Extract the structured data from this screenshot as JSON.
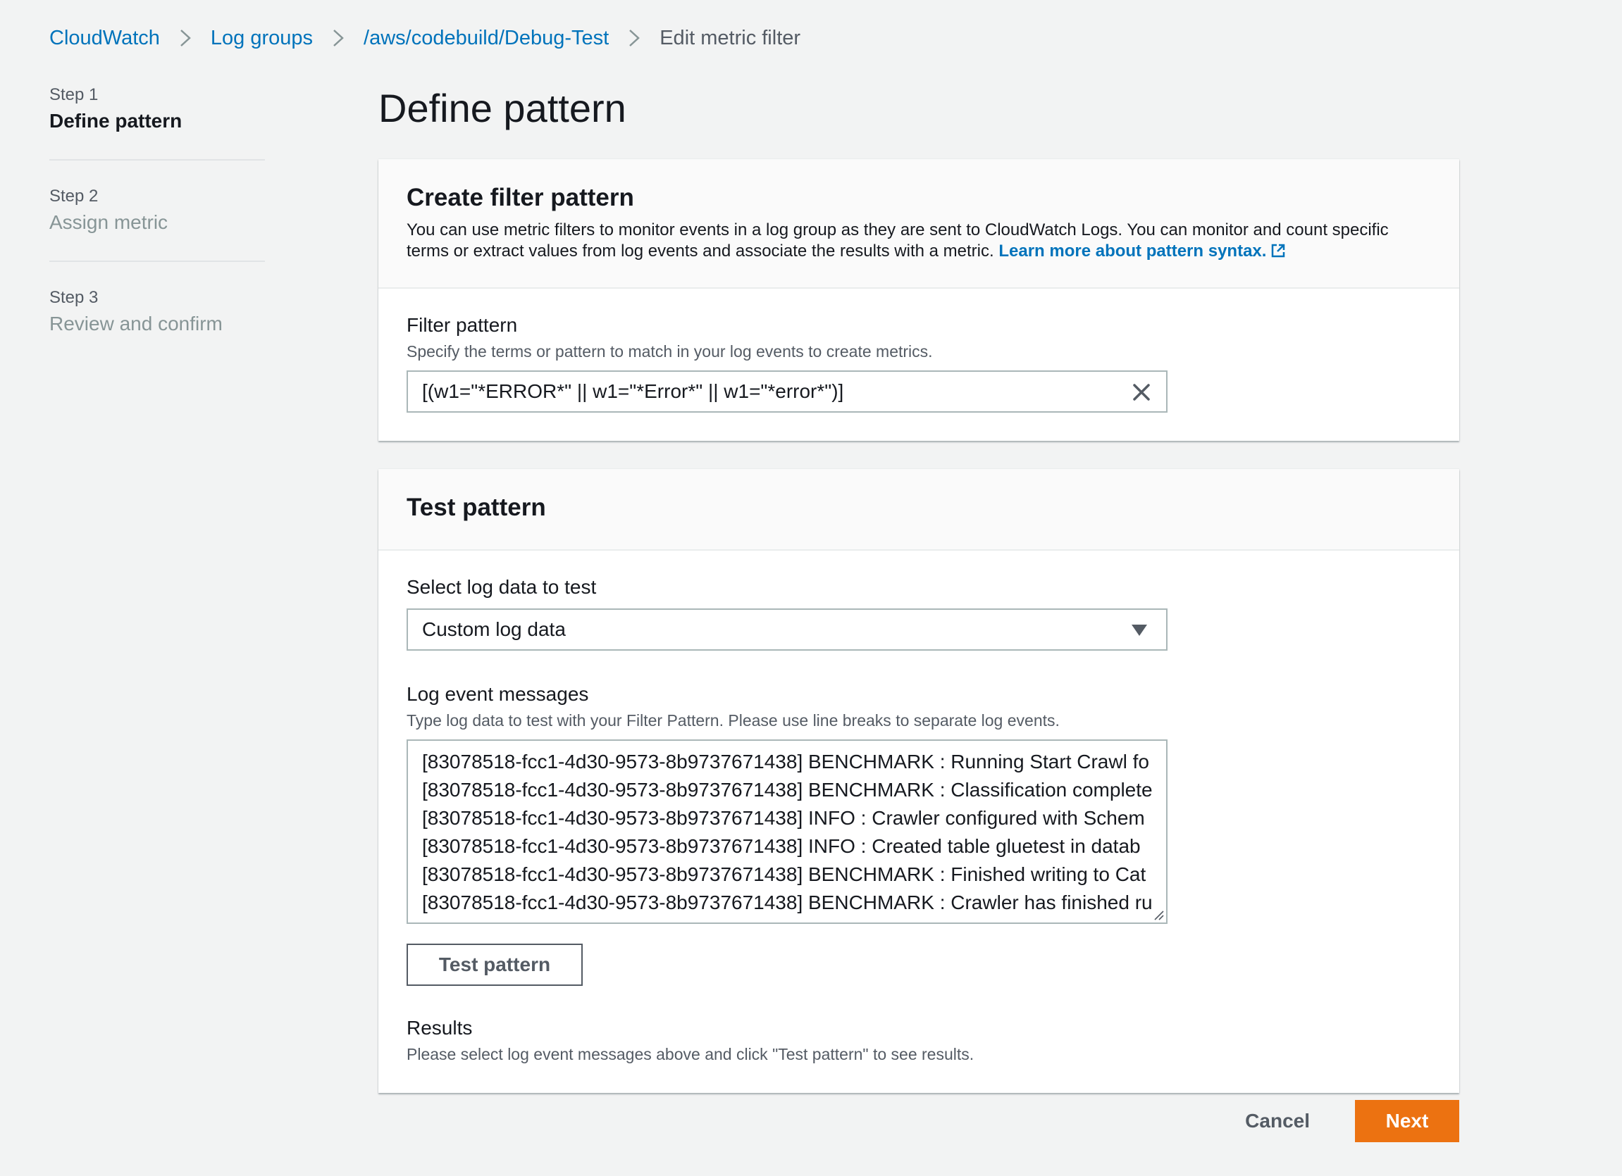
{
  "breadcrumb": {
    "items": [
      {
        "label": "CloudWatch"
      },
      {
        "label": "Log groups"
      },
      {
        "label": "/aws/codebuild/Debug-Test"
      }
    ],
    "current": "Edit metric filter"
  },
  "steps": [
    {
      "num": "Step 1",
      "title": "Define pattern"
    },
    {
      "num": "Step 2",
      "title": "Assign metric"
    },
    {
      "num": "Step 3",
      "title": "Review and confirm"
    }
  ],
  "page_title": "Define pattern",
  "create_filter": {
    "title": "Create filter pattern",
    "description": "You can use metric filters to monitor events in a log group as they are sent to CloudWatch Logs. You can monitor and count specific terms or extract values from log events and associate the results with a metric.",
    "learn_more": "Learn more about pattern syntax.",
    "filter_label": "Filter pattern",
    "filter_desc": "Specify the terms or pattern to match in your log events to create metrics.",
    "filter_value": "[(w1=\"*ERROR*\" || w1=\"*Error*\" || w1=\"*error*\")]"
  },
  "test_pattern": {
    "title": "Test pattern",
    "select_label": "Select log data to test",
    "select_value": "Custom log data",
    "messages_label": "Log event messages",
    "messages_desc": "Type log data to test with your Filter Pattern. Please use line breaks to separate log events.",
    "messages": [
      "[83078518-fcc1-4d30-9573-8b9737671438] BENCHMARK : Running Start Crawl fo",
      "[83078518-fcc1-4d30-9573-8b9737671438] BENCHMARK : Classification complete",
      "[83078518-fcc1-4d30-9573-8b9737671438] INFO : Crawler configured with Schem",
      "[83078518-fcc1-4d30-9573-8b9737671438] INFO : Created table gluetest in datab",
      "[83078518-fcc1-4d30-9573-8b9737671438] BENCHMARK : Finished writing to Cat",
      "[83078518-fcc1-4d30-9573-8b9737671438] BENCHMARK : Crawler has finished ru"
    ],
    "button_label": "Test pattern",
    "results_label": "Results",
    "results_desc": "Please select log event messages above and click \"Test pattern\" to see results."
  },
  "footer": {
    "cancel_label": "Cancel",
    "next_label": "Next"
  },
  "colors": {
    "link": "#0073bb",
    "primary": "#ec7211",
    "background": "#f2f3f3"
  }
}
